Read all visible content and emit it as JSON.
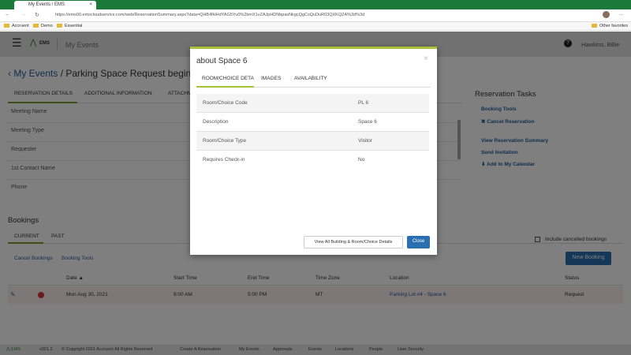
{
  "browser": {
    "tab_title": "My Events / EMS",
    "url": "https://ems00.emscloudservice.com/web/ReservationSummary.aspx?data=QHB4fHHdYAG5Yu0%2bmX1vZAJpHDNbpasNkgcQgCsQuDuR03QXKQZA%3d%3d",
    "bookmarks": [
      "Accruent",
      "Demo",
      "Essential"
    ],
    "other_favorites": "Other favorites"
  },
  "app": {
    "logo": "EMS",
    "section": "My Events",
    "user": "Hawkins, Billie"
  },
  "breadcrumb": {
    "back": "My Events",
    "title": "/ Parking Space Request beginning A"
  },
  "detail_tabs": [
    "RESERVATION DETAILS",
    "ADDITIONAL INFORMATION",
    "ATTACHM"
  ],
  "detail_fields": [
    "Meeting Name",
    "Meeting Type",
    "Requester",
    "1st Contact Name",
    "Phone"
  ],
  "tasks": {
    "title": "Reservation Tasks",
    "items": [
      "Booking Tools",
      "Cancel Reservation",
      "View Reservation Summary",
      "Send Invitation",
      "Add to My Calendar"
    ]
  },
  "bookings": {
    "title": "Bookings",
    "tabs": [
      "CURRENT",
      "PAST"
    ],
    "cancel": "Cancel Bookings",
    "tools": "Booking Tools",
    "include_cancelled": "Include cancelled bookings",
    "new_booking": "New Booking",
    "columns": [
      "Date",
      "Start Time",
      "End Time",
      "Time Zone",
      "Location",
      "Status"
    ],
    "rows": [
      {
        "date": "Mon Aug 30, 2021",
        "start": "8:00 AM",
        "end": "5:00 PM",
        "tz": "MT",
        "location": "Parking Lot #4 - Space 6",
        "status": "Request"
      }
    ]
  },
  "footer": {
    "version": "v321.2",
    "copyright": "© Copyright 2021 Accruent All Rights Reserved",
    "links": [
      "Create A Reservation",
      "My Events",
      "Approvals",
      "Events",
      "Locations",
      "People",
      "User Security"
    ]
  },
  "modal": {
    "title": "about Space 6",
    "close": "×",
    "tabs": [
      "ROOM/CHOICE DETA",
      "IMAGES",
      "AVAILABILITY"
    ],
    "rows": [
      {
        "label": "Room/Choice Code",
        "value": "PL 6"
      },
      {
        "label": "Description",
        "value": "Space 6"
      },
      {
        "label": "Room/Choice Type",
        "value": "Visitor"
      },
      {
        "label": "Requires Check-in",
        "value": "No"
      }
    ],
    "view_all": "View All Building & Room/Choice Details",
    "close_btn": "Close"
  },
  "colors": {
    "accent": "#a7c13a",
    "link": "#1f5f9e",
    "primary": "#2a6fb0"
  }
}
